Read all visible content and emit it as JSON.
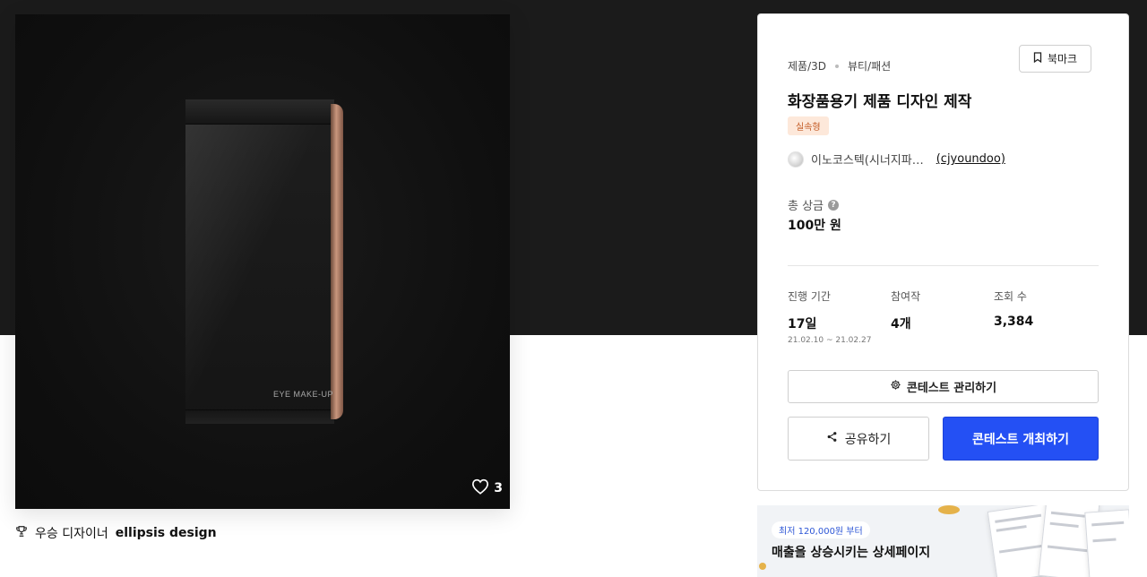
{
  "product": {
    "image_label": "EYE MAKE-UP",
    "like_count": "3"
  },
  "winner": {
    "prefix": "우승 디자이너",
    "name": "ellipsis design"
  },
  "contest": {
    "category_primary": "제품/3D",
    "category_secondary": "뷰티/패션",
    "bookmark_label": "북마크",
    "title": "화장품용기 제품 디자인 제작",
    "badge": "실속형",
    "host_name": "이노코스텍(시너지파…",
    "host_id": "(cjyoundoo)",
    "prize_label": "총 상금",
    "prize_value": "100만 원",
    "stats": {
      "period_label": "진행 기간",
      "period_value": "17일",
      "period_range": "21.02.10 ~ 21.02.27",
      "entries_label": "참여작",
      "entries_value": "4개",
      "views_label": "조회 수",
      "views_value": "3,384"
    },
    "manage_label": "콘테스트 관리하기",
    "share_label": "공유하기",
    "host_contest_label": "콘테스트 개최하기"
  },
  "promo": {
    "chip": "최저 120,000원 부터",
    "headline": "매출을 상승시키는 상세페이지"
  },
  "colors": {
    "primary_button": "#2450f4",
    "badge_bg": "#fde8da",
    "badge_text": "#c45b25",
    "hero_band": "#1b1b1b"
  },
  "icons": [
    "heart-icon",
    "trophy-icon",
    "bookmark-icon",
    "help-icon",
    "gear-icon",
    "share-icon"
  ]
}
